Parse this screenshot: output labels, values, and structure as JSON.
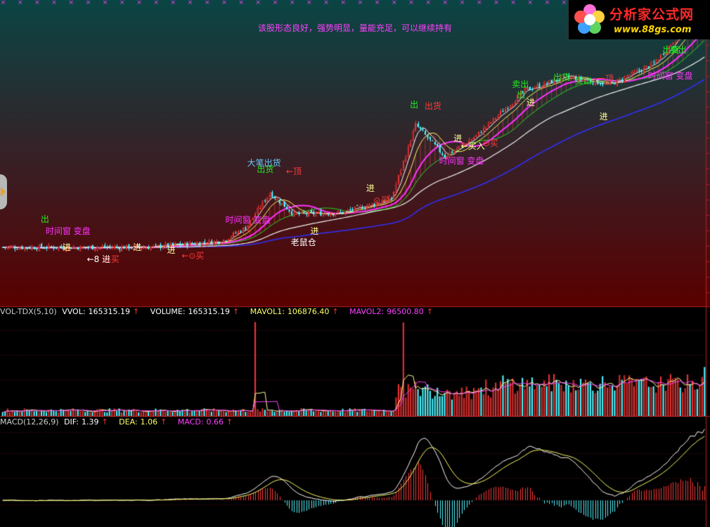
{
  "message": "该股形态良好，强势明显，量能充足，可以继续持有",
  "logo": {
    "title": "分析家公式网",
    "url": "www.88gs.com"
  },
  "colors": {
    "up": "#ff3a3a",
    "down": "#4ff7ff",
    "ma5": "#ffffff",
    "ma10": "#ffff66",
    "ma20": "#ff33ff",
    "ma30": "#22dd22",
    "ma60": "#f0f0f0",
    "ma120": "#3030ff",
    "grid": "#b02020",
    "mavol2": "#ff40ff",
    "msg": "#ff40ff"
  },
  "vol_header": {
    "name": "VOL-TDX(5,10)",
    "vvol_label": "VVOL:",
    "vvol": "165315.19",
    "volume_label": "VOLUME:",
    "volume": "165315.19",
    "mavol1_label": "MAVOL1:",
    "mavol1": "106876.40",
    "mavol2_label": "MAVOL2:",
    "mavol2": "96500.80"
  },
  "macd_header": {
    "name": "MACD(12,26,9)",
    "dif_label": "DIF:",
    "dif": "1.39",
    "dea_label": "DEA:",
    "dea": "1.06",
    "macd_label": "MACD:",
    "macd": "0.66"
  },
  "annotations": [
    {
      "text": "出",
      "color": "#22ee22",
      "i": 18,
      "price": 3.15
    },
    {
      "text": "时间窗 变盘",
      "color": "#ff33ff",
      "i": 20,
      "price": 2.6
    },
    {
      "text": "进",
      "color": "#ffff99",
      "i": 27,
      "price": 2.05
    },
    {
      "text": "←8 进",
      "color": "#ffffff",
      "i": 37,
      "price": 1.7
    },
    {
      "text": "⊙买",
      "color": "#ff3a3a",
      "i": 44,
      "price": 1.7
    },
    {
      "text": "进",
      "color": "#ffff99",
      "i": 56,
      "price": 2.05
    },
    {
      "text": "进",
      "color": "#ffff99",
      "i": 70,
      "price": 1.95
    },
    {
      "text": "←⊙买",
      "color": "#ff3a3a",
      "i": 76,
      "price": 1.8
    },
    {
      "text": "时间窗 变盘",
      "color": "#ff33ff",
      "i": 94,
      "price": 3.1
    },
    {
      "text": "大笔出货",
      "color": "#66ccff",
      "i": 103,
      "price": 7.4
    },
    {
      "text": "出货",
      "color": "#22ee22",
      "i": 107,
      "price": 6.7
    },
    {
      "text": "←顶",
      "color": "#ff3a3a",
      "i": 119,
      "price": 6.5
    },
    {
      "text": "老鼠仓",
      "color": "#ffffff",
      "i": 121,
      "price": 2.2
    },
    {
      "text": "进",
      "color": "#ffff99",
      "i": 129,
      "price": 2.6
    },
    {
      "text": "进",
      "color": "#ffff99",
      "i": 152,
      "price": 5.0
    },
    {
      "text": "⊙买",
      "color": "#ff3a3a",
      "i": 155,
      "price": 4.2
    },
    {
      "text": "出",
      "color": "#22ee22",
      "i": 170,
      "price": 18.0
    },
    {
      "text": "出货",
      "color": "#ff3a3a",
      "i": 176,
      "price": 17.6
    },
    {
      "text": "时间窗 变盘",
      "color": "#ff33ff",
      "i": 182,
      "price": 7.6
    },
    {
      "text": "进",
      "color": "#ffff99",
      "i": 188,
      "price": 10.8
    },
    {
      "text": "←买入",
      "color": "#ffff99",
      "i": 191,
      "price": 9.6
    },
    {
      "text": "⊙买",
      "color": "#ff3a3a",
      "i": 200,
      "price": 10.0
    },
    {
      "text": "卖出",
      "color": "#22ee22",
      "i": 212,
      "price": 24.5
    },
    {
      "text": "出",
      "color": "#22ee22",
      "i": 214,
      "price": 21.0
    },
    {
      "text": "进",
      "color": "#ffff99",
      "i": 218,
      "price": 18.5
    },
    {
      "text": "出货",
      "color": "#22ee22",
      "i": 229,
      "price": 27.5
    },
    {
      "text": "卖出",
      "color": "#22ee22",
      "i": 238,
      "price": 26.0
    },
    {
      "text": "一顶",
      "color": "#ff3a3a",
      "i": 247,
      "price": 26.8
    },
    {
      "text": "进",
      "color": "#ffff99",
      "i": 248,
      "price": 15.0
    },
    {
      "text": "时间窗 变盘",
      "color": "#ff33ff",
      "i": 268,
      "price": 28.0
    },
    {
      "text": "出货",
      "color": "#22ee22",
      "i": 274,
      "price": 62.0
    },
    {
      "text": "卖出",
      "color": "#22ee22",
      "i": 277,
      "price": 54.0
    }
  ],
  "chart_data": {
    "type": "candlestick",
    "price_scale": "log",
    "ylim": [
      1.3,
      80
    ],
    "bars": 290,
    "series_summary": "Price rises from about 2 to about 80 over 290 bars with moving averages MA5, MA10, MA20, MA30, MA60, MA120",
    "volume_ylim": [
      0,
      330000
    ],
    "macd_ylim": [
      -0.55,
      2.1
    ],
    "last": {
      "volume": 165315.19,
      "mavol1": 106876.4,
      "mavol2": 96500.8,
      "dif": 1.39,
      "dea": 1.06,
      "macd": 0.66
    }
  }
}
